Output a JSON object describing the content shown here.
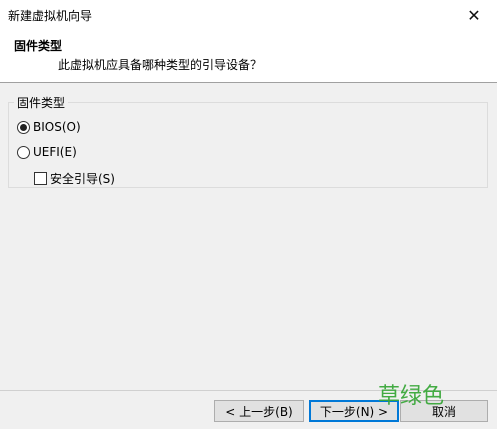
{
  "window": {
    "title": "新建虚拟机向导",
    "close_glyph": "✕"
  },
  "header": {
    "title": "固件类型",
    "subtitle": "此虚拟机应具备哪种类型的引导设备？"
  },
  "firmware_group": {
    "legend": "固件类型",
    "options": [
      {
        "label": "BIOS(O)",
        "selected": true
      },
      {
        "label": "UEFI(E)",
        "selected": false
      }
    ],
    "secure_boot": {
      "label": "安全引导(S)",
      "checked": false
    }
  },
  "footer": {
    "back_label": "< 上一步(B)",
    "next_label": "下一步(N) >",
    "cancel_label": "取消"
  },
  "watermark": "草绿色"
}
